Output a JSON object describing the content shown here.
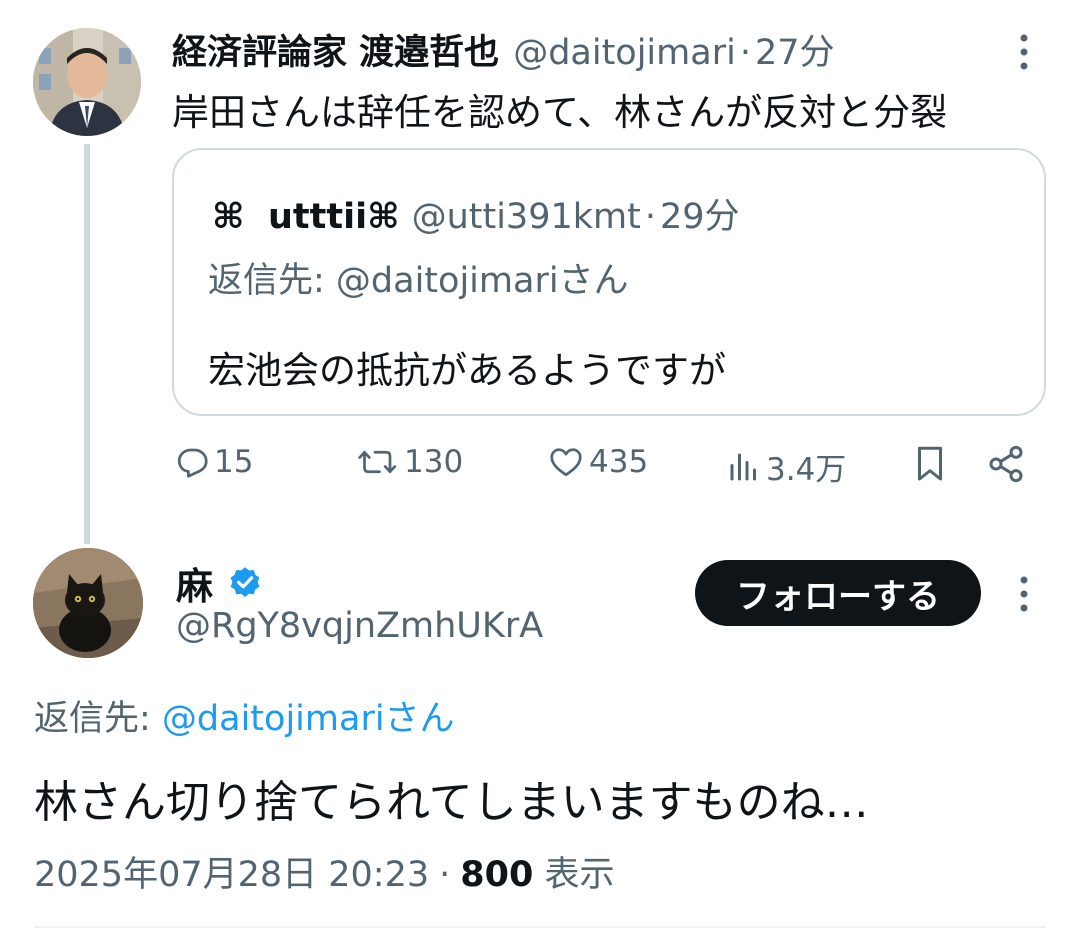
{
  "parent_tweet": {
    "author_name": "経済評論家 渡邉哲也",
    "handle": "@daitojimari",
    "time": "27分",
    "separator": "·",
    "text": "岸田さんは辞任を認めて、林さんが反対と分裂",
    "quote": {
      "symbol": "⌘",
      "author_name": "utttii⌘",
      "handle": "@utti391kmt",
      "time": "29分",
      "reply_label": "返信先: ",
      "reply_handle": "@daitojimariさん",
      "text": "宏池会の抵抗があるようですが"
    },
    "actions": {
      "replies": "15",
      "retweets": "130",
      "likes": "435",
      "views": "3.4万"
    }
  },
  "reply_tweet": {
    "author_name": "麻",
    "verified": true,
    "handle": "@RgY8vqjnZmhUKrA",
    "follow_label": "フォローする",
    "reply_label": "返信先: ",
    "reply_handle": "@daitojimariさん",
    "text": "林さん切り捨てられてしまいますものね…",
    "timestamp": "2025年07月28日 20:23",
    "separator": "·",
    "view_count": "800",
    "view_label": "表示"
  },
  "colors": {
    "text_primary": "#0f1419",
    "text_secondary": "#536471",
    "link": "#1d9bf0",
    "border": "#cfd9de"
  }
}
